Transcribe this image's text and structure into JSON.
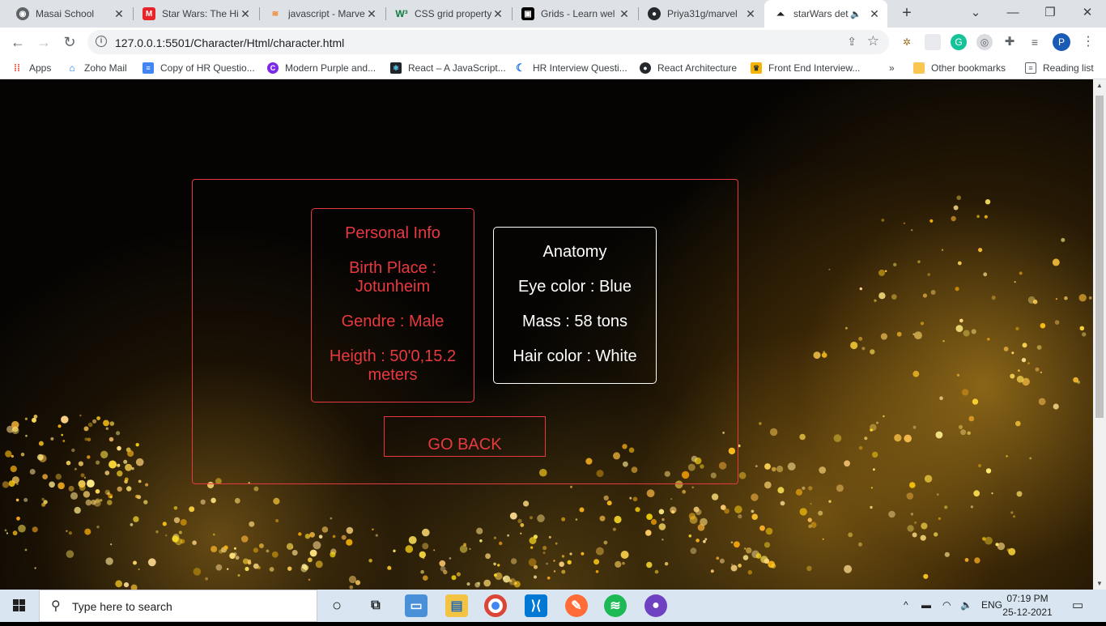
{
  "browser": {
    "tabs": [
      {
        "title": "Masai School",
        "icon": "globe-icon",
        "color": "#5f6368"
      },
      {
        "title": "Star Wars: The Hi",
        "icon": "marvel-icon",
        "color": "#e62429"
      },
      {
        "title": "javascript - Marve",
        "icon": "stackoverflow-icon",
        "color": "#f48024"
      },
      {
        "title": "CSS grid property",
        "icon": "w3-icon",
        "color": "#0f7b3d"
      },
      {
        "title": "Grids - Learn wel",
        "icon": "mdn-icon",
        "color": "#000000"
      },
      {
        "title": "Priya31g/marvel",
        "icon": "github-icon",
        "color": "#24292e"
      },
      {
        "title": "starWars det",
        "icon": "starwars-icon",
        "color": "#202124"
      }
    ],
    "url": "127.0.0.1:5501/Character/Html/character.html",
    "bookmarks": [
      {
        "label": "Apps",
        "icon": "apps-grid-icon"
      },
      {
        "label": "Zoho Mail",
        "icon": "zoho-icon"
      },
      {
        "label": "Copy of HR Questio...",
        "icon": "docs-icon"
      },
      {
        "label": "Modern Purple and...",
        "icon": "canva-icon"
      },
      {
        "label": "React – A JavaScript...",
        "icon": "react-icon"
      },
      {
        "label": "HR Interview Questi...",
        "icon": "bookmark-icon"
      },
      {
        "label": "React Architecture",
        "icon": "github-icon"
      },
      {
        "label": "Front End Interview...",
        "icon": "trophy-icon"
      },
      {
        "label": "»",
        "icon": ""
      },
      {
        "label": "Other bookmarks",
        "icon": "folder-icon"
      },
      {
        "label": "Reading list",
        "icon": "reading-list-icon"
      }
    ],
    "profile_initial": "P"
  },
  "character": {
    "personal": {
      "title": "Personal Info",
      "birth_place": "Birth Place : Jotunheim",
      "gender": "Gendre : Male",
      "height": "Heigth : 50'0,15.2 meters"
    },
    "anatomy": {
      "title": "Anatomy",
      "eye": "Eye color : Blue",
      "mass": "Mass : 58 tons",
      "hair": "Hair color : White"
    },
    "go_back": "GO BACK",
    "accent_color": "#e8393f"
  },
  "taskbar": {
    "search_placeholder": "Type here to search",
    "lang": "ENG",
    "time": "07:19 PM",
    "date": "25-12-2021"
  }
}
